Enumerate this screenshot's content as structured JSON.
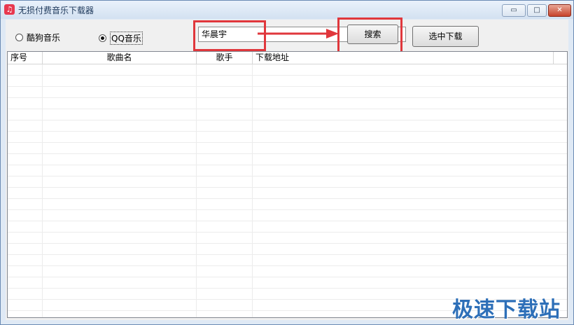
{
  "window": {
    "title": "无损付费音乐下载器",
    "controls": {
      "minimize": "▭",
      "maximize": "□",
      "close": "✕"
    }
  },
  "source_options": [
    {
      "label": "酷狗音乐",
      "selected": false
    },
    {
      "label": "QQ音乐",
      "selected": true
    }
  ],
  "search": {
    "value": "华晨宇"
  },
  "buttons": {
    "search_label": "搜索",
    "download_label": "选中下载"
  },
  "table": {
    "columns": [
      "序号",
      "歌曲名",
      "歌手",
      "下载地址"
    ],
    "rows": []
  },
  "watermark": "极速下载站",
  "colors": {
    "highlight": "#e0373c",
    "watermark": "#2d6fb8"
  }
}
